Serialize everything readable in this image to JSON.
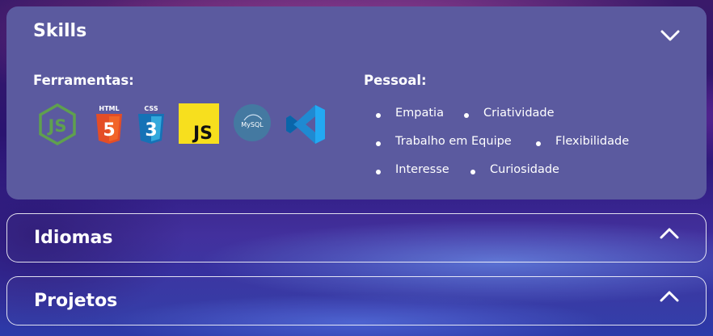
{
  "sections": {
    "skills": {
      "title": "Skills",
      "expanded": true,
      "toggle_icon": "chevron-down-icon",
      "tools_heading": "Ferramentas:",
      "tools": [
        {
          "name": "nodejs-icon"
        },
        {
          "name": "html5-icon",
          "label": "HTML",
          "glyph": "5"
        },
        {
          "name": "css3-icon",
          "label": "CSS",
          "glyph": "3"
        },
        {
          "name": "javascript-icon",
          "glyph": "JS"
        },
        {
          "name": "mysql-icon",
          "glyph": "MySQL"
        },
        {
          "name": "vscode-icon"
        }
      ],
      "personal_heading": "Pessoal:",
      "personal": [
        [
          "Empatia",
          "Criatividade"
        ],
        [
          "Trabalho em Equipe",
          "Flexibilidade"
        ],
        [
          "Interesse",
          "Curiosidade"
        ]
      ]
    },
    "idiomas": {
      "title": "Idiomas",
      "expanded": false,
      "toggle_icon": "chevron-up-icon"
    },
    "projetos": {
      "title": "Projetos",
      "expanded": false,
      "toggle_icon": "chevron-up-icon"
    }
  },
  "colors": {
    "card_bg": "#5b5a9f",
    "node_green": "#5fa04e",
    "html_orange": "#e44d26",
    "css_blue": "#1572b6",
    "js_yellow": "#f7df1e",
    "mysql_blue": "#4479a1",
    "vscode_blue": "#23a9f2"
  }
}
